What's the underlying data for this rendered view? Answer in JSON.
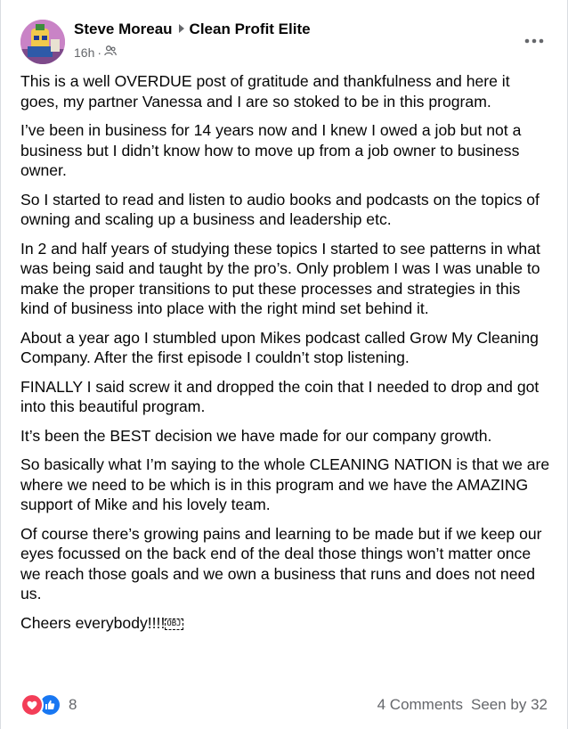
{
  "post": {
    "author": "Steve Moreau",
    "group": "Clean Profit Elite",
    "time": "16h",
    "separator": "·",
    "paragraphs": [
      "This is a well OVERDUE post of gratitude and thankfulness and here it goes, my partner Vanessa and I are so stoked to be in this program.",
      "I’ve been in business for 14 years now and I knew I owed a job but not a business but I didn’t know how to move up from a job owner to business owner.",
      "So I started to read and listen to audio books and podcasts on the topics of owning and scaling up a business and leadership etc.",
      "In 2 and half years of studying these topics I started to see patterns in what was being said and taught by the pro’s.  Only problem I was I was unable to make the proper transitions to put these processes and strategies in this kind of business into place with the right mind set behind it.",
      "About a year ago I stumbled upon Mikes podcast called Grow My Cleaning Company. After the first episode I couldn’t stop listening.",
      "FINALLY I said screw it and dropped the coin that I needed to drop and got into this beautiful program.",
      "It’s been the BEST decision we have made for our company growth.",
      "So basically what I’m saying to the whole CLEANING NATION is that we are where we need to be which is  in this program and we have the AMAZING support of Mike and his lovely team.",
      "Of course there’s growing pains and learning to be made but if we keep our eyes focussed on the back end of the deal those things won’t matter once we reach those goals and we own a business that runs and does not need us."
    ],
    "closing": "Cheers everybody!!!!",
    "closing_glyph": "OBJ"
  },
  "footer": {
    "reaction_count": "8",
    "comments": "4 Comments",
    "seen_by": "Seen by 32"
  },
  "icons": {
    "more": "more-options-icon",
    "privacy": "group-privacy-icon",
    "love": "love-reaction-icon",
    "like": "like-reaction-icon",
    "arrow": "caret-right-icon"
  },
  "colors": {
    "like_blue": "#1877f2",
    "love_red": "#f33e58",
    "secondary_text": "#65676b"
  }
}
